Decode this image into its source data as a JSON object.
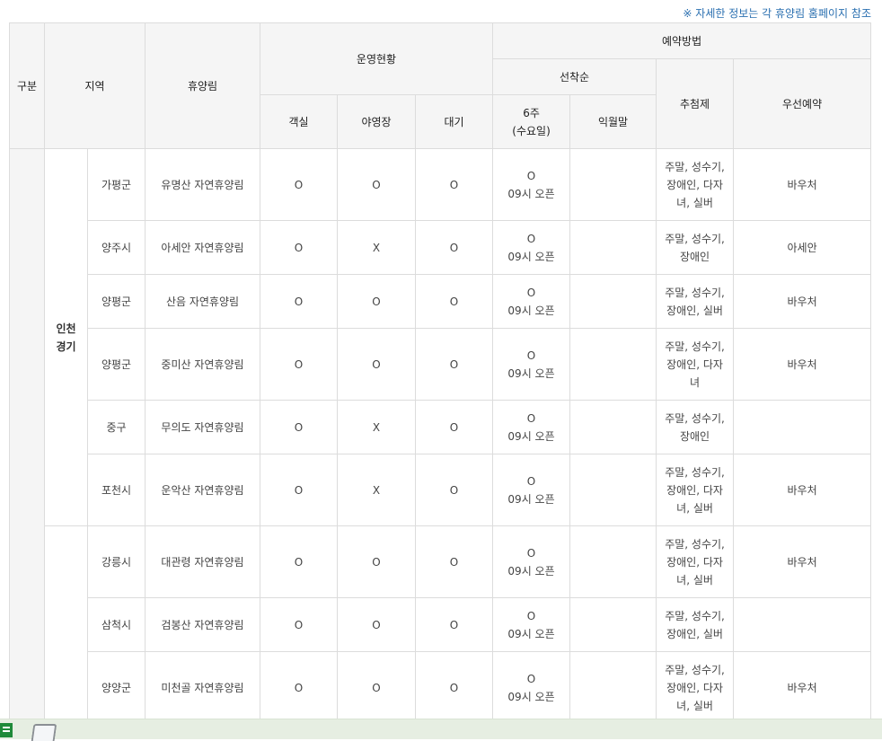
{
  "note": "※ 자세한 정보는 각 휴양림 홈페이지 참조",
  "header": {
    "category": "구분",
    "region": "지역",
    "forest": "휴양림",
    "operation": "운영현황",
    "reservation": "예약방법",
    "first_come": "선착순",
    "room": "객실",
    "camping": "야영장",
    "waiting": "대기",
    "six_weeks": "6주\n(수요일)",
    "next_month": "익월말",
    "lottery": "추첨제",
    "priority": "우선예약"
  },
  "groups": [
    {
      "category": "",
      "region": "인천\n경기"
    },
    {
      "category": "",
      "region": ""
    }
  ],
  "rows": [
    {
      "district": "가평군",
      "forest": "유명산 자연휴양림",
      "room": "O",
      "camping": "O",
      "waiting": "O",
      "six_weeks": "O\n09시 오픈",
      "next_month": "",
      "lottery": "주말, 성수기,\n장애인, 다자\n녀, 실버",
      "priority": "바우처"
    },
    {
      "district": "양주시",
      "forest": "아세안 자연휴양림",
      "room": "O",
      "camping": "X",
      "waiting": "O",
      "six_weeks": "O\n09시 오픈",
      "next_month": "",
      "lottery": "주말, 성수기,\n장애인",
      "priority": "아세안"
    },
    {
      "district": "양평군",
      "forest": "산음 자연휴양림",
      "room": "O",
      "camping": "O",
      "waiting": "O",
      "six_weeks": "O\n09시 오픈",
      "next_month": "",
      "lottery": "주말, 성수기,\n장애인, 실버",
      "priority": "바우처"
    },
    {
      "district": "양평군",
      "forest": "중미산 자연휴양림",
      "room": "O",
      "camping": "O",
      "waiting": "O",
      "six_weeks": "O\n09시 오픈",
      "next_month": "",
      "lottery": "주말, 성수기,\n장애인, 다자\n녀",
      "priority": "바우처"
    },
    {
      "district": "중구",
      "forest": "무의도 자연휴양림",
      "room": "O",
      "camping": "X",
      "waiting": "O",
      "six_weeks": "O\n09시 오픈",
      "next_month": "",
      "lottery": "주말, 성수기,\n장애인",
      "priority": ""
    },
    {
      "district": "포천시",
      "forest": "운악산 자연휴양림",
      "room": "O",
      "camping": "X",
      "waiting": "O",
      "six_weeks": "O\n09시 오픈",
      "next_month": "",
      "lottery": "주말, 성수기,\n장애인, 다자\n녀, 실버",
      "priority": "바우처"
    },
    {
      "district": "강릉시",
      "forest": "대관령 자연휴양림",
      "room": "O",
      "camping": "O",
      "waiting": "O",
      "six_weeks": "O\n09시 오픈",
      "next_month": "",
      "lottery": "주말, 성수기,\n장애인, 다자\n녀, 실버",
      "priority": "바우처"
    },
    {
      "district": "삼척시",
      "forest": "검봉산 자연휴양림",
      "room": "O",
      "camping": "O",
      "waiting": "O",
      "six_weeks": "O\n09시 오픈",
      "next_month": "",
      "lottery": "주말, 성수기,\n장애인, 실버",
      "priority": ""
    },
    {
      "district": "양양군",
      "forest": "미천골 자연휴양림",
      "room": "O",
      "camping": "O",
      "waiting": "O",
      "six_weeks": "O\n09시 오픈",
      "next_month": "",
      "lottery": "주말, 성수기,\n장애인, 다자\n녀, 실버",
      "priority": "바우처"
    }
  ],
  "icons": {
    "taskbar_left": "spreadsheet-icon",
    "taskbar_right": "document-icon"
  }
}
